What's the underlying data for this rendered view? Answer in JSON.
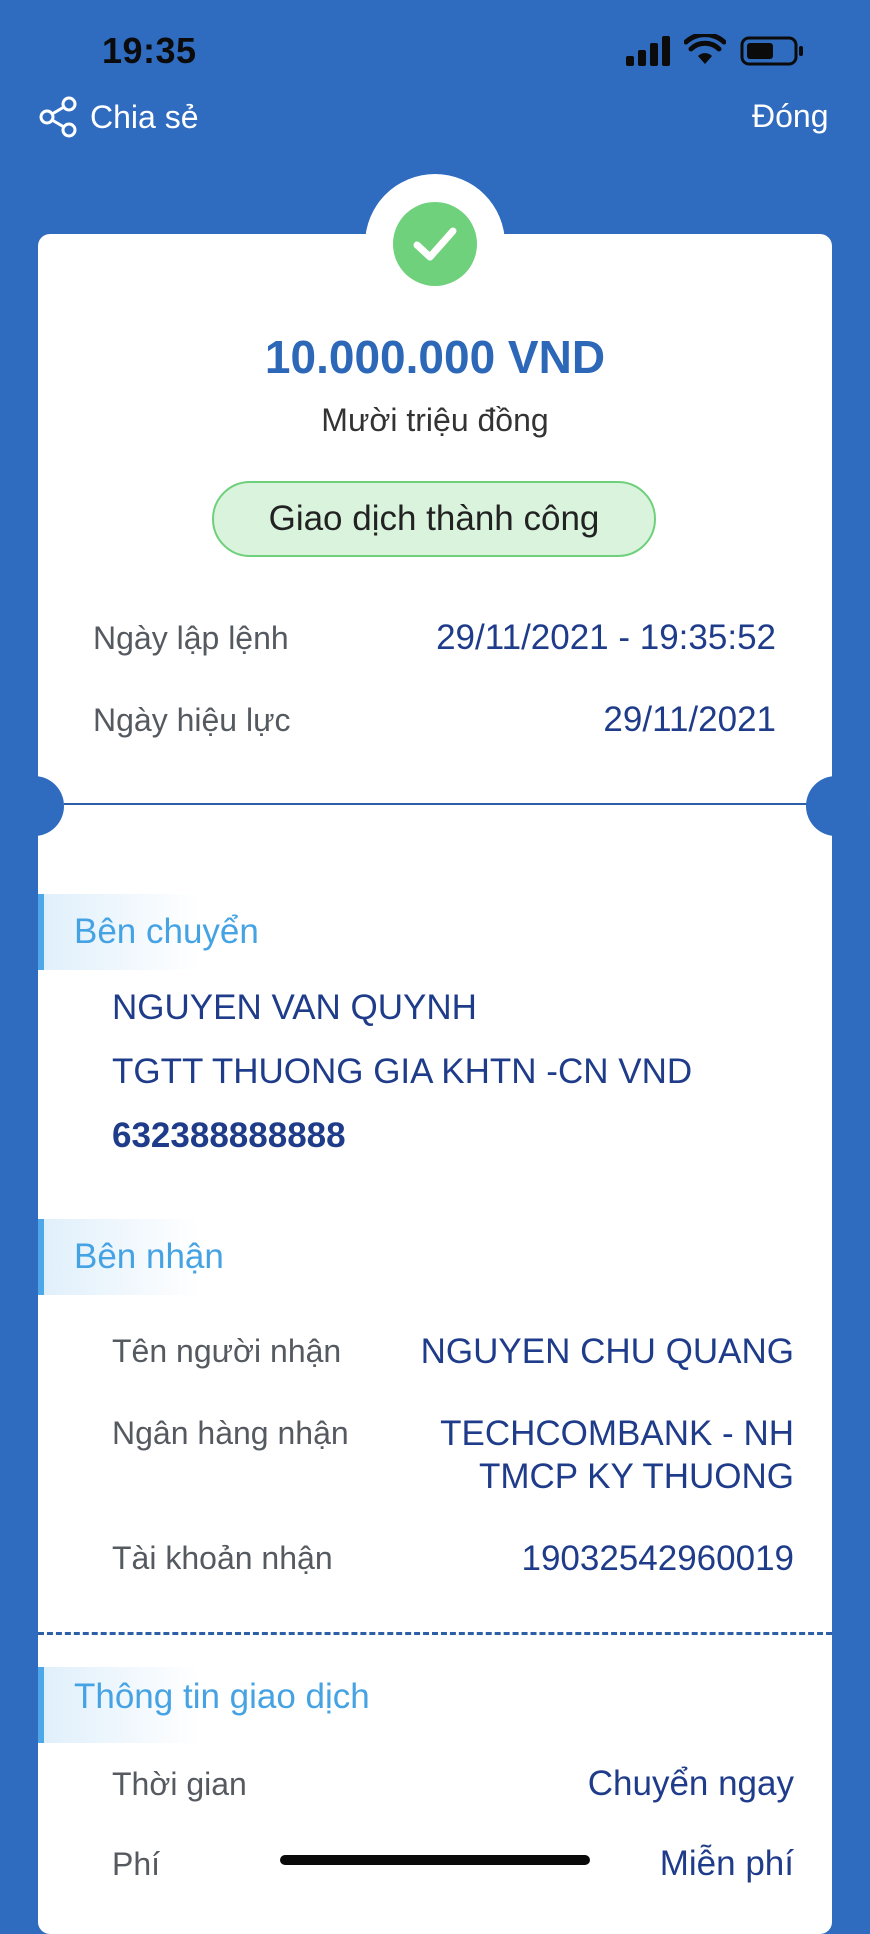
{
  "status_bar": {
    "time": "19:35"
  },
  "nav": {
    "share_label": "Chia sẻ",
    "close_label": "Đóng"
  },
  "summary": {
    "amount": "10.000.000 VND",
    "amount_words": "Mười triệu đồng",
    "status": "Giao dịch thành công",
    "colors": {
      "success": "#6fd17c",
      "accent": "#2d67b8",
      "background": "#2f6bbf"
    }
  },
  "dates": [
    {
      "label": "Ngày lập lệnh",
      "value": "29/11/2021 - 19:35:52"
    },
    {
      "label": "Ngày hiệu lực",
      "value": "29/11/2021"
    }
  ],
  "sender": {
    "title": "Bên chuyển",
    "name": "NGUYEN VAN QUYNH",
    "account_type": "TGTT THUONG GIA KHTN -CN VND",
    "account_number": "632388888888"
  },
  "receiver": {
    "title": "Bên nhận",
    "rows": [
      {
        "label": "Tên người nhận",
        "value": "NGUYEN CHU QUANG"
      },
      {
        "label": "Ngân hàng nhận",
        "value_line1": "TECHCOMBANK - NH",
        "value_line2": "TMCP KY THUONG"
      },
      {
        "label": "Tài khoản nhận",
        "value": "19032542960019"
      }
    ]
  },
  "transaction_info": {
    "title": "Thông tin giao dịch",
    "rows": [
      {
        "label": "Thời gian",
        "value": "Chuyển ngay"
      },
      {
        "label": "Phí",
        "value": "Miễn phí"
      }
    ]
  },
  "icons": [
    "share-icon",
    "check-icon",
    "signal-icon",
    "wifi-icon",
    "battery-icon"
  ]
}
